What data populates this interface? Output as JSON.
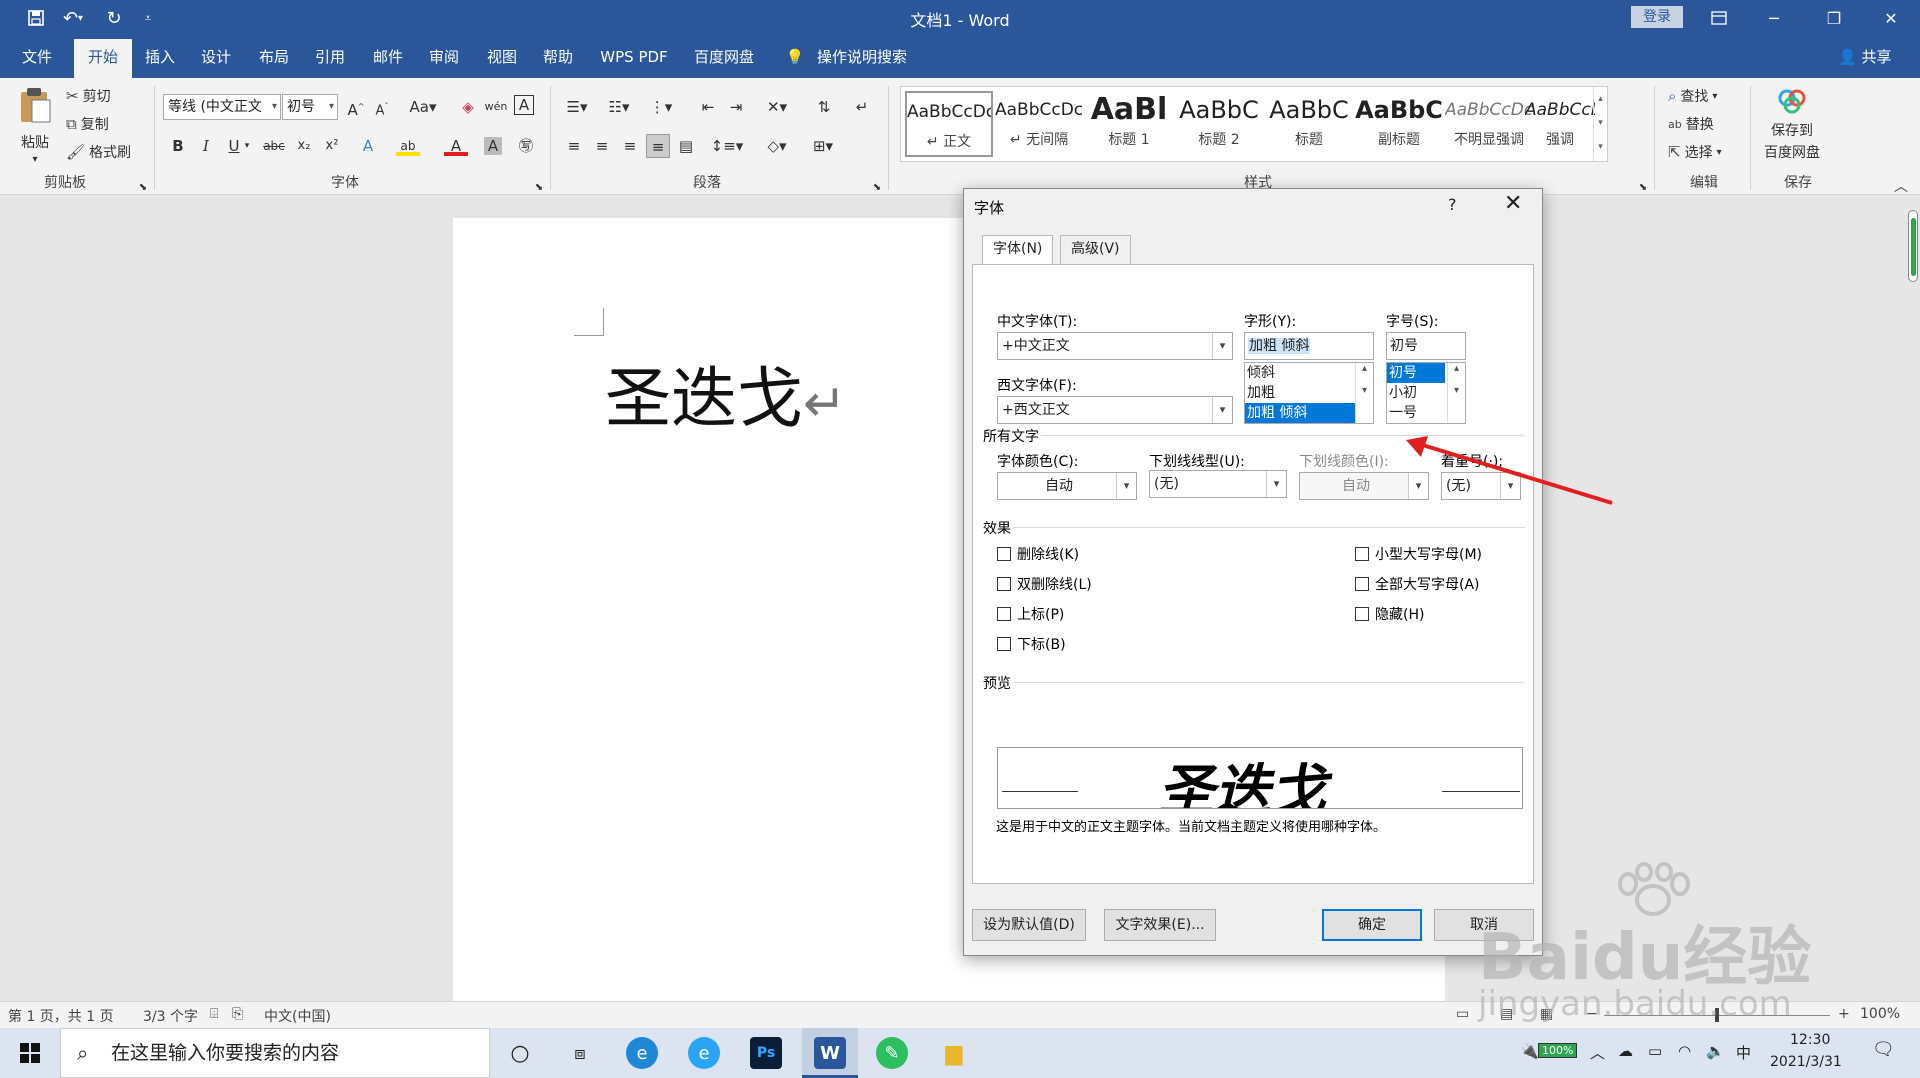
{
  "window": {
    "title": "文档1  -  Word",
    "login_label": "登录",
    "qa_save_icon": "save-icon",
    "qa_undo_icon": "undo-icon",
    "qa_redo_icon": "redo-icon"
  },
  "menu": {
    "tabs": [
      "文件",
      "开始",
      "插入",
      "设计",
      "布局",
      "引用",
      "邮件",
      "审阅",
      "视图",
      "帮助",
      "WPS PDF",
      "百度网盘"
    ],
    "tell_me": "操作说明搜索",
    "share": "共享"
  },
  "ribbon": {
    "clipboard": {
      "paste": "粘贴",
      "cut": "剪切",
      "copy": "复制",
      "format_painter": "格式刷",
      "label": "剪贴板"
    },
    "font": {
      "font_name": "等线 (中文正文",
      "font_size": "初号",
      "label": "字体"
    },
    "paragraph": {
      "label": "段落"
    },
    "styles": {
      "label": "样式",
      "items": [
        {
          "sample": "AaBbCcDc",
          "name": "↵ 正文"
        },
        {
          "sample": "AaBbCcDc",
          "name": "↵ 无间隔"
        },
        {
          "sample": "AaBl",
          "name": "标题 1"
        },
        {
          "sample": "AaBbC",
          "name": "标题 2"
        },
        {
          "sample": "AaBbC",
          "name": "标题"
        },
        {
          "sample": "AaBbC",
          "name": "副标题"
        },
        {
          "sample": "AaBbCcDc",
          "name": "不明显强调"
        },
        {
          "sample": "AaBbCcDc",
          "name": "强调"
        }
      ]
    },
    "editing": {
      "find": "查找",
      "replace": "替换",
      "select": "选择",
      "label": "编辑"
    },
    "save": {
      "button": "保存到\n百度网盘",
      "line1": "保存到",
      "line2": "百度网盘",
      "label": "保存"
    }
  },
  "document": {
    "text": "圣迭戈",
    "para_mark": "↵"
  },
  "status": {
    "page": "第 1 页，共 1 页",
    "words": "3/3 个字",
    "language": "中文(中国)",
    "zoom": "100%"
  },
  "taskbar": {
    "search_placeholder": "在这里输入你要搜索的内容",
    "battery": "100%",
    "ime": "中",
    "time": "12:30",
    "date": "2021/3/31"
  },
  "dialog": {
    "title": "字体",
    "help": "?",
    "tabs": [
      "字体(N)",
      "高级(V)"
    ],
    "cn_font_label": "中文字体(T):",
    "cn_font_value": "+中文正文",
    "west_font_label": "西文字体(F):",
    "west_font_value": "+西文正文",
    "style_label": "字形(Y):",
    "style_value": "加粗 倾斜",
    "style_options": [
      "倾斜",
      "加粗",
      "加粗 倾斜"
    ],
    "size_label": "字号(S):",
    "size_value": "初号",
    "size_options": [
      "初号",
      "小初",
      "一号"
    ],
    "all_text_section": "所有文字",
    "font_color_label": "字体颜色(C):",
    "font_color_value": "自动",
    "underline_label": "下划线线型(U):",
    "underline_value": "(无)",
    "underline_color_label": "下划线颜色(I):",
    "underline_color_value": "自动",
    "emphasis_label": "着重号(·);",
    "emphasis_value": "(无)",
    "effects_section": "效果",
    "effects_left": [
      "删除线(K)",
      "双删除线(L)",
      "上标(P)",
      "下标(B)"
    ],
    "effects_right": [
      "小型大写字母(M)",
      "全部大写字母(A)",
      "隐藏(H)"
    ],
    "preview_section": "预览",
    "preview_text": "圣迭戈",
    "preview_desc": "这是用于中文的正文主题字体。当前文档主题定义将使用哪种字体。",
    "btn_default": "设为默认值(D)",
    "btn_effects": "文字效果(E)...",
    "btn_ok": "确定",
    "btn_cancel": "取消"
  },
  "watermark": {
    "main": "Baidu经验",
    "sub": "jingyan.baidu.com"
  },
  "colors": {
    "brand": "#2b579a",
    "selection": "#0078d7",
    "arrow": "#e02020"
  }
}
